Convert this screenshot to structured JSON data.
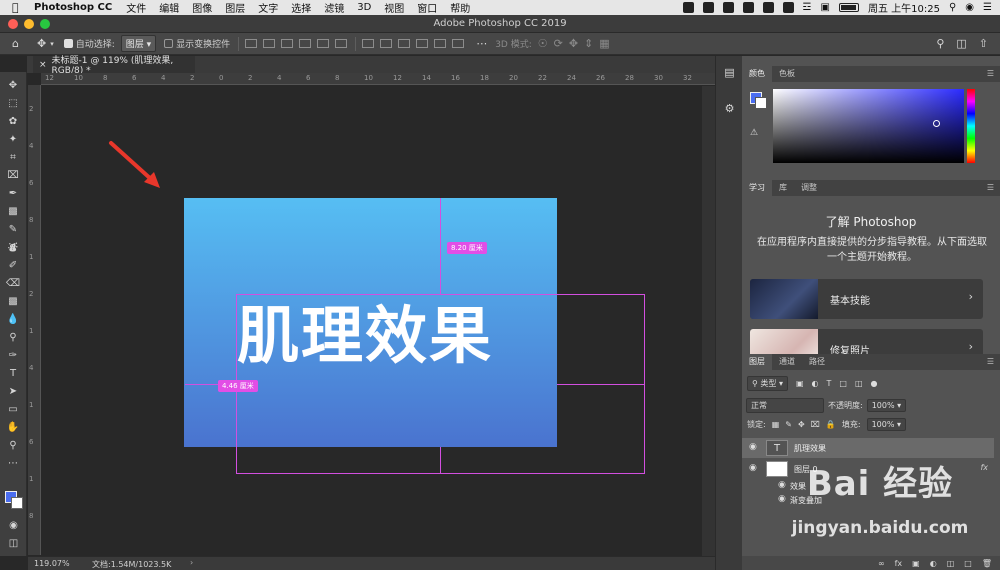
{
  "menubar": {
    "app_name": "Photoshop CC",
    "items": [
      "文件",
      "编辑",
      "图像",
      "图层",
      "文字",
      "选择",
      "滤镜",
      "3D",
      "视图",
      "窗口",
      "帮助"
    ],
    "clock": "周五 上午10:25"
  },
  "window": {
    "title": "Adobe Photoshop CC 2019"
  },
  "options": {
    "auto_select_label": "自动选择:",
    "auto_select_value": "图层",
    "show_transform_label": "显示变换控件",
    "mode_3d_label": "3D 模式:"
  },
  "document": {
    "tab_title": "未标题-1 @ 119% (肌理效果, RGB/8) *",
    "canvas_text": "肌理效果",
    "measure_top": "8.20 厘米",
    "measure_left": "4.46 厘米",
    "gradient_top": "#56bef3",
    "gradient_bottom": "#4a73cf"
  },
  "ruler": {
    "h_labels": [
      "12",
      "10",
      "8",
      "6",
      "4",
      "2",
      "0",
      "2",
      "4",
      "6",
      "8",
      "10",
      "12",
      "14",
      "16",
      "18",
      "20",
      "22",
      "24",
      "26",
      "28",
      "30",
      "32"
    ],
    "v_labels": [
      "2",
      "4",
      "6",
      "8",
      "1",
      "2",
      "1",
      "4",
      "1",
      "6",
      "1",
      "8"
    ]
  },
  "status": {
    "zoom": "119.07%",
    "doc_size": "文档:1.54M/1023.5K"
  },
  "panels": {
    "color_tabs": [
      "颜色",
      "色板"
    ],
    "learn_tabs": [
      "学习",
      "库",
      "调整"
    ],
    "learn_heading": "了解 Photoshop",
    "learn_desc": "在应用程序内直接提供的分步指导教程。从下面选取一个主题开始教程。",
    "card1": "基本技能",
    "card2": "修复照片",
    "layers_tabs": [
      "图层",
      "通道",
      "路径"
    ],
    "filter_kind": "类型",
    "blend_mode": "正常",
    "opacity_label": "不透明度:",
    "opacity_value": "100%",
    "lock_label": "锁定:",
    "fill_label": "填充:",
    "fill_value": "100%",
    "layer1_name": "肌理效果",
    "layer2_name": "图层 0",
    "effects_label": "效果",
    "gradient_overlay_label": "渐变叠加",
    "fx_label": "fx"
  },
  "watermark": {
    "brand": "Bai 经验",
    "url": "jingyan.baidu.com"
  },
  "colors": {
    "foreground": "#4a6df0",
    "background": "#ffffff",
    "guide": "#d24fe0"
  }
}
